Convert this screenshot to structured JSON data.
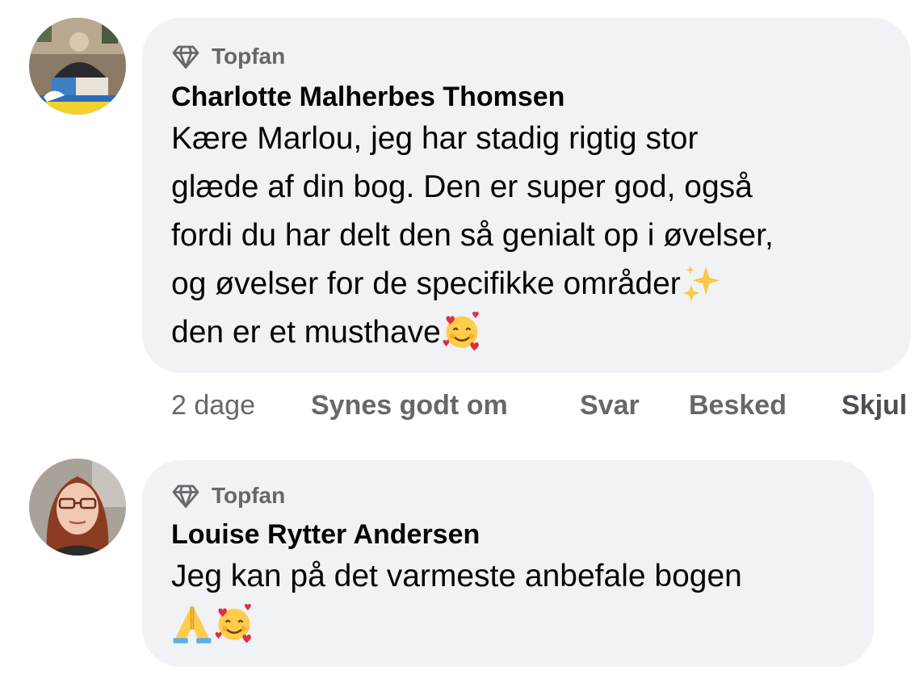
{
  "comments": [
    {
      "badge": "Topfan",
      "author": "Charlotte Malherbes Thomsen",
      "lines": [
        "Kære Marlou, jeg har stadig rigtig stor",
        "glæde af din bog. Den er super god, også",
        "fordi du har delt den så genialt op i øvelser,",
        "og øvelser for de specifikke områder",
        "den er et musthave"
      ],
      "avatar_icon": "profile-photo-woman-with-flag",
      "emoji": [
        "sparkles-emoji",
        "smiling-face-with-hearts-emoji"
      ]
    },
    {
      "badge": "Topfan",
      "author": "Louise Rytter Andersen",
      "lines": [
        "Jeg kan på det varmeste anbefale bogen"
      ],
      "avatar_icon": "profile-photo-woman-with-glasses",
      "emoji": [
        "folded-hands-emoji",
        "smiling-face-with-hearts-emoji"
      ]
    }
  ],
  "actions": {
    "time": "2 dage",
    "like": "Synes godt om",
    "reply": "Svar",
    "message": "Besked",
    "hide": "Skjul"
  },
  "colors": {
    "bubble": "#f0f2f5",
    "secondary_text": "#65676b",
    "primary_text": "#050505"
  }
}
